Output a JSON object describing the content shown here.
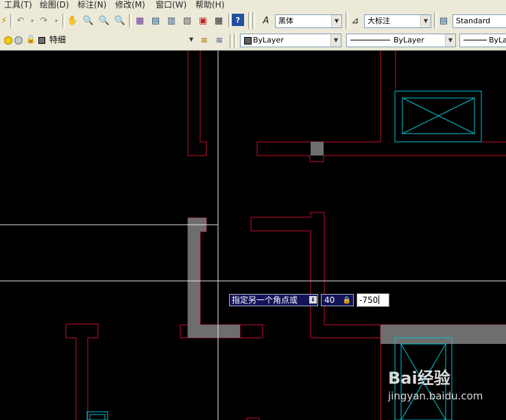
{
  "menu": {
    "items": [
      "工具(T)",
      "绘图(D)",
      "标注(N)",
      "修改(M)",
      "窗口(W)",
      "帮助(H)"
    ]
  },
  "toolbar1": {
    "text_style": "黑体",
    "dim_style": "大标注",
    "table_style": "Standard",
    "icons": [
      "match-properties-icon",
      "undo-icon",
      "redo-icon",
      "pan-icon",
      "zoom-realtime-icon",
      "zoom-window-icon",
      "zoom-previous-icon",
      "properties-icon",
      "design-center-icon",
      "tool-palettes-icon",
      "sheet-set-icon",
      "markup-icon",
      "calculator-icon",
      "help-icon",
      "text-style-icon",
      "dim-style-icon",
      "table-style-icon"
    ]
  },
  "toolbar2": {
    "layer_name": "特细",
    "color": "ByLayer",
    "linetype": "ByLayer",
    "lineweight": "ByLay"
  },
  "command": {
    "prompt": "指定另一个角点或",
    "length_value": "40",
    "input_value": "-750"
  },
  "colors": {
    "wall_outline": "#c8102e",
    "window": "#00c8d8",
    "fill": "#6e6e6e",
    "crosshair": "#e8e8e8",
    "ui_bg": "#ece9d8"
  },
  "watermark": {
    "logo": "Bai经验",
    "url": "jingyan.baidu.com"
  }
}
